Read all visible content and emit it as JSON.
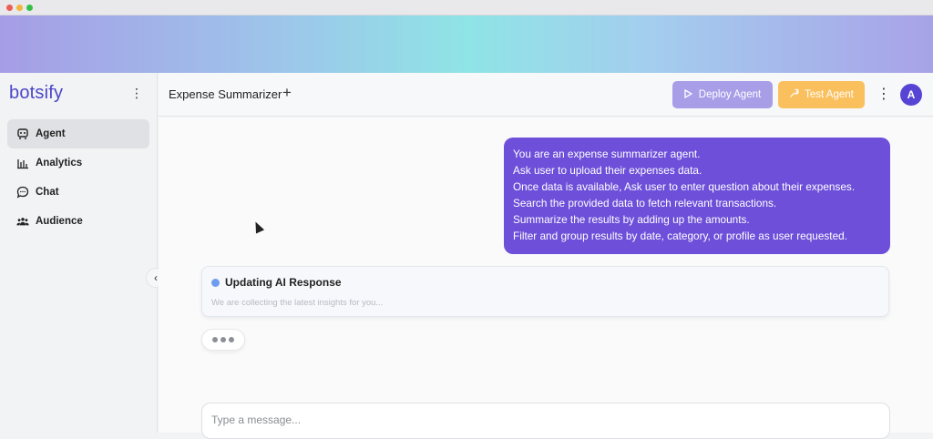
{
  "app": {
    "logo": "botsify",
    "colors": {
      "brand": "#4b46c9",
      "accent": "#6d4fd9",
      "deploy": "#a89ee8",
      "test": "#fbc05e"
    }
  },
  "sidebar": {
    "items": [
      {
        "label": "Agent",
        "icon": "robot-icon",
        "active": true
      },
      {
        "label": "Analytics",
        "icon": "bar-chart-icon",
        "active": false
      },
      {
        "label": "Chat",
        "icon": "chat-bubble-icon",
        "active": false
      },
      {
        "label": "Audience",
        "icon": "users-icon",
        "active": false
      }
    ]
  },
  "header": {
    "title": "Expense Summarizer",
    "deploy_label": "Deploy Agent",
    "test_label": "Test Agent",
    "avatar_initial": "A"
  },
  "chat": {
    "prompt_lines": [
      "You are an expense summarizer agent.",
      "Ask user to upload their expenses data.",
      "Once data is available, Ask user to enter question about their expenses.",
      "Search the provided data to fetch relevant transactions.",
      "Summarize the results by adding up the amounts.",
      "Filter and group results by date, category, or profile as user requested."
    ],
    "status_title": "Updating AI Response",
    "status_subtitle": "We are collecting the latest insights for you...",
    "input_placeholder": "Type a message..."
  }
}
